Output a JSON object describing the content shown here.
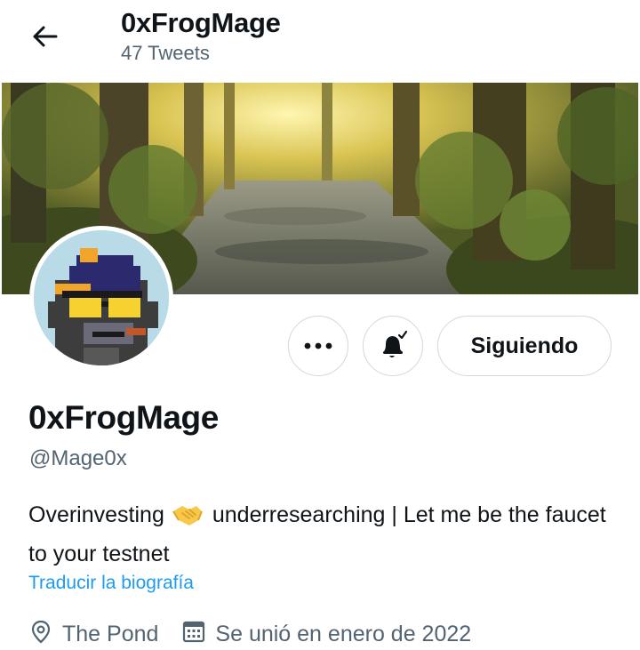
{
  "header": {
    "title": "0xFrogMage",
    "tweet_count": "47 Tweets"
  },
  "profile": {
    "display_name": "0xFrogMage",
    "handle": "@Mage0x",
    "bio_part1": "Overinvesting",
    "bio_part2": "underresearching | Let me be the faucet to your testnet",
    "translate_label": "Traducir la biografía",
    "location": "The Pond",
    "joined": "Se unió en enero de 2022"
  },
  "actions": {
    "more_label": "•••",
    "follow_label": "Siguiendo"
  },
  "colors": {
    "link": "#1d9bf0",
    "secondary_text": "#536471",
    "border": "#cfd9de"
  },
  "icons": [
    "back-arrow-icon",
    "more-icon",
    "bell-subscribed-icon",
    "handshake-emoji-icon",
    "location-icon",
    "calendar-icon"
  ]
}
